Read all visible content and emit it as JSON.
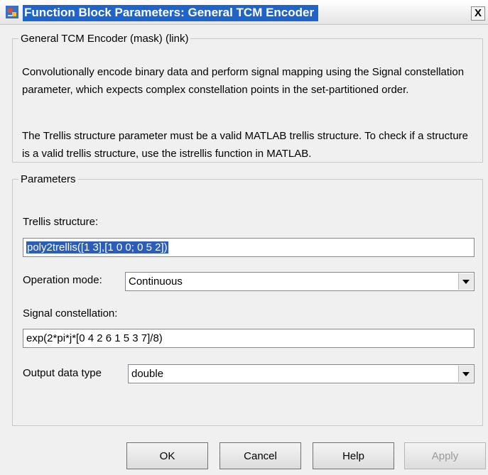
{
  "window": {
    "title": "Function Block Parameters: General TCM Encoder",
    "close_label": "X"
  },
  "description": {
    "legend": "General TCM Encoder (mask) (link)",
    "paragraph1": "Convolutionally encode binary data and perform signal mapping using the Signal constellation parameter, which expects complex constellation points in the set-partitioned order.",
    "paragraph2": "The Trellis structure parameter must be a valid MATLAB trellis structure. To check if a structure is a valid trellis structure, use the istrellis function in MATLAB."
  },
  "parameters": {
    "legend": "Parameters",
    "trellis_label": "Trellis structure:",
    "trellis_value": "poly2trellis([1 3],[1 0 0; 0 5 2])",
    "operation_mode_label": "Operation mode:",
    "operation_mode_value": "Continuous",
    "constellation_label": "Signal constellation:",
    "constellation_value": "exp(2*pi*j*[0 4 2 6 1 5 3 7]/8)",
    "output_type_label": "Output data type",
    "output_type_value": "double"
  },
  "buttons": {
    "ok": "OK",
    "cancel": "Cancel",
    "help": "Help",
    "apply": "Apply"
  },
  "colors": {
    "title_highlight": "#1f64c8",
    "selection": "#2c5db8"
  },
  "icons": {
    "window_icon": "simulink-block-icon",
    "dropdown": "chevron-down-icon"
  }
}
